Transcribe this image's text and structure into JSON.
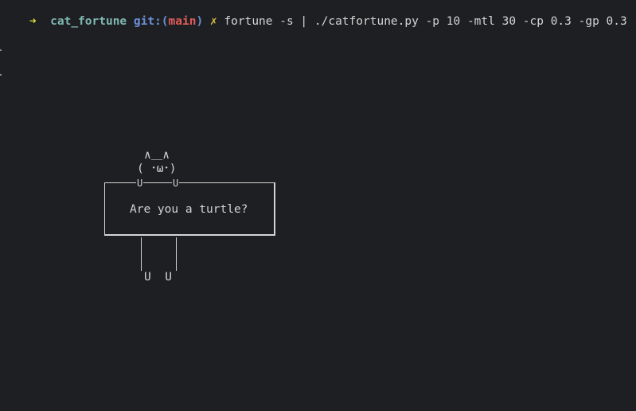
{
  "prompt": {
    "arrow": "➜",
    "directory": "cat_fortune",
    "git_prefix": "git:(",
    "branch": "main",
    "git_suffix": ")",
    "dirty_marker": "✗",
    "command": "fortune -s | ./catfortune.py -p 10 -mtl 30 -cp 0.3 -gp 0.3"
  },
  "cat": {
    "ears": "∧＿∧",
    "face": "( ･ω･)",
    "paw_left": "U",
    "paw_right": "U",
    "feet": "U  U"
  },
  "bubble": {
    "message": "Are you a turtle?"
  }
}
